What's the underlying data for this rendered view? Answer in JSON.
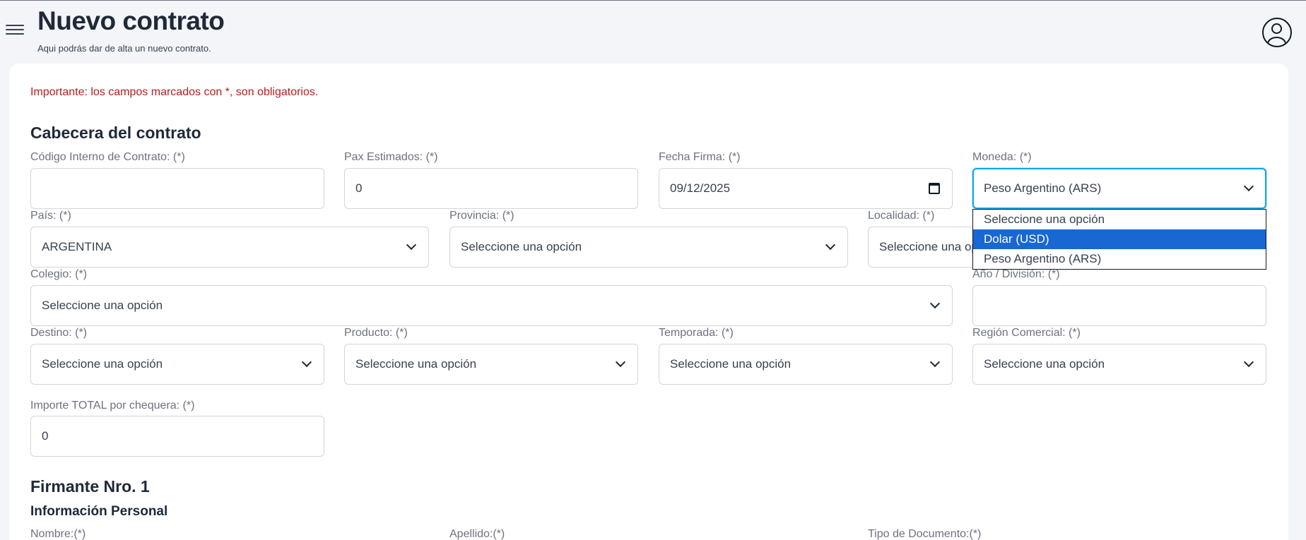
{
  "header": {
    "title": "Nuevo contrato",
    "subtitle": "Aqui podrás dar de alta un nuevo contrato."
  },
  "warning": "Importante: los campos marcados con *, son obligatorios.",
  "section_header": "Cabecera del contrato",
  "fields": {
    "codigo": {
      "label": "Código Interno de Contrato: (*)",
      "value": ""
    },
    "pax": {
      "label": "Pax Estimados: (*)",
      "value": "0"
    },
    "fecha": {
      "label": "Fecha Firma: (*)",
      "value": "09/12/2025"
    },
    "moneda": {
      "label": "Moneda: (*)",
      "value": "Peso Argentino (ARS)"
    },
    "pais": {
      "label": "País: (*)",
      "value": "ARGENTINA"
    },
    "provincia": {
      "label": "Provincia: (*)",
      "value": "Seleccione una opción"
    },
    "localidad": {
      "label": "Localidad: (*)",
      "value": "Seleccione una opción"
    },
    "colegio": {
      "label": "Colegio: (*)",
      "value": "Seleccione una opción"
    },
    "anio": {
      "label": "Año / División: (*)",
      "value": ""
    },
    "destino": {
      "label": "Destino: (*)",
      "value": "Seleccione una opción"
    },
    "producto": {
      "label": "Producto: (*)",
      "value": "Seleccione una opción"
    },
    "temporada": {
      "label": "Temporada: (*)",
      "value": "Seleccione una opción"
    },
    "region": {
      "label": "Región Comercial: (*)",
      "value": "Seleccione una opción"
    },
    "importe": {
      "label": "Importe TOTAL por chequera: (*)",
      "value": "0"
    }
  },
  "moneda_options": [
    "Seleccione una opción",
    "Dolar (USD)",
    "Peso Argentino (ARS)"
  ],
  "moneda_highlighted": "Dolar (USD)",
  "firmante": {
    "title": "Firmante Nro. 1",
    "subtitle": "Información Personal",
    "nombre_label": "Nombre:(*)",
    "apellido_label": "Apellido:(*)",
    "tipo_doc_label": "Tipo de Documento:(*)"
  },
  "colors": {
    "focus": "#0ea5e9",
    "highlight": "#1967d2",
    "warning": "#b91c1c"
  },
  "icons": [
    "menu-icon",
    "user-avatar-icon",
    "chevron-down-icon",
    "calendar-icon"
  ]
}
